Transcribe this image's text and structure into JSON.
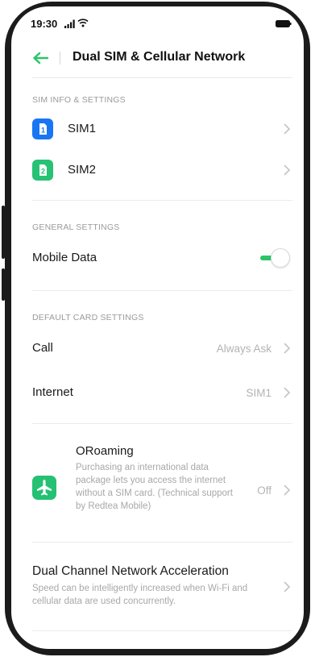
{
  "status_bar": {
    "time": "19:30"
  },
  "header": {
    "title": "Dual SIM & Cellular Network"
  },
  "sim_section": {
    "label": "SIM INFO & SETTINGS",
    "items": [
      {
        "label": "SIM1",
        "icon_text": "1",
        "color": "#1976f2"
      },
      {
        "label": "SIM2",
        "icon_text": "2",
        "color": "#27c274"
      }
    ]
  },
  "general_section": {
    "label": "GENERAL SETTINGS",
    "mobile_data": {
      "label": "Mobile Data",
      "enabled": true
    }
  },
  "default_section": {
    "label": "DEFAULT CARD SETTINGS",
    "call": {
      "label": "Call",
      "value": "Always Ask"
    },
    "internet": {
      "label": "Internet",
      "value": "SIM1"
    }
  },
  "oroaming": {
    "title": "ORoaming",
    "description": "Purchasing an international data package lets you access the internet without a SIM card. (Technical support by Redtea Mobile)",
    "value": "Off",
    "icon": "airplane-icon",
    "color": "#25c173"
  },
  "dual_channel": {
    "title": "Dual Channel Network Acceleration",
    "description": "Speed can be intelligently increased when Wi-Fi and cellular data are used concurrently."
  },
  "colors": {
    "accent_green": "#2bc468",
    "sim1_blue": "#1976f2",
    "secondary_text": "#a8a8a8"
  }
}
